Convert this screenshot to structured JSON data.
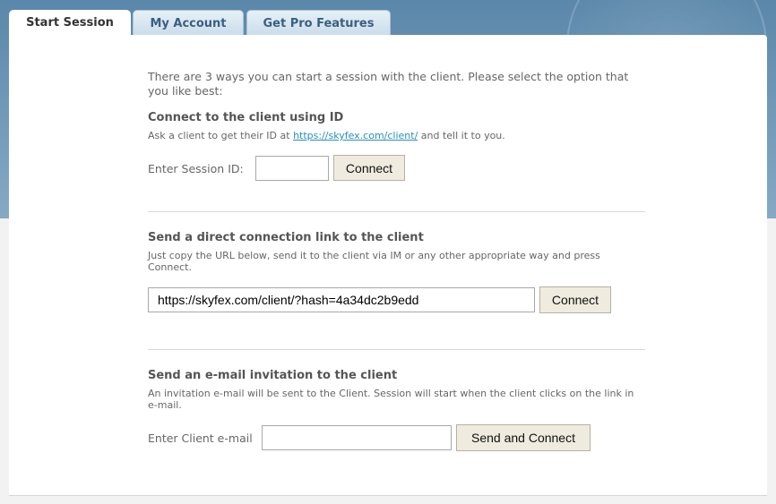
{
  "tabs": [
    {
      "label": "Start Session",
      "active": true
    },
    {
      "label": "My Account",
      "active": false
    },
    {
      "label": "Get Pro Features",
      "active": false
    }
  ],
  "intro": "There are 3 ways you can start a session with the client. Please select the option that you like best:",
  "section_id": {
    "title": "Connect to the client using ID",
    "desc_before": "Ask a client to get their ID at ",
    "link_text": "https://skyfex.com/client/",
    "desc_after": " and tell it to you.",
    "label": "Enter Session ID:",
    "input_value": "",
    "button": "Connect"
  },
  "section_link": {
    "title": "Send a direct connection link to the client",
    "desc": "Just copy the URL below, send it to the client via IM or any other appropriate way and press Connect.",
    "url_value": "https://skyfex.com/client/?hash=4a34dc2b9edd",
    "button": "Connect"
  },
  "section_email": {
    "title": "Send an e-mail invitation to the client",
    "desc": "An invitation e-mail will be sent to the Client. Session will start when the client clicks on the link in e-mail.",
    "label": "Enter Client e-mail",
    "input_value": "",
    "button": "Send and Connect"
  },
  "colors": {
    "banner": "#5b87aa",
    "panel": "#ffffff",
    "link": "#2a8fbd",
    "button_bg": "#efebdf",
    "tab_inactive_text": "#3a5f80"
  }
}
